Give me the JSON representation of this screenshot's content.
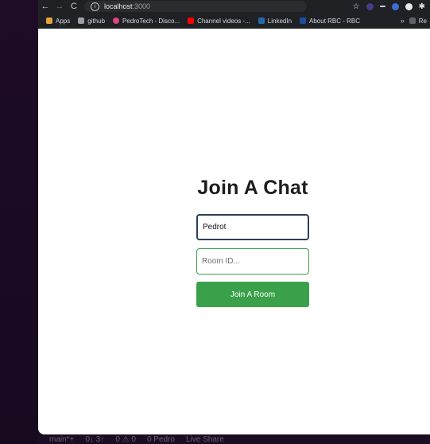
{
  "browser": {
    "url_host": "localhost",
    "url_port": ":3000",
    "bookmarks": [
      {
        "label": "Apps",
        "icon": "apps-grid-icon",
        "color": "#e8a13a"
      },
      {
        "label": "github",
        "icon": "folder-icon",
        "color": "#9aa0a6"
      },
      {
        "label": "PedroTech - Disco...",
        "icon": "discord-icon",
        "color": "#e0457b"
      },
      {
        "label": "Channel videos -...",
        "icon": "youtube-icon",
        "color": "#ff0000"
      },
      {
        "label": "LinkedIn",
        "icon": "linkedin-icon",
        "color": "#2867b2"
      },
      {
        "label": "About RBC - RBC",
        "icon": "rbc-icon",
        "color": "#1a4fa0"
      }
    ],
    "more_label": "»",
    "reading_list_label": "Re"
  },
  "page": {
    "title": "Join A Chat",
    "username_value": "Pedrot",
    "room_placeholder": "Room ID...",
    "join_button": "Join A Room"
  },
  "statusbar": {
    "branch": "main*+",
    "sync": "0↓ 3↑",
    "problems": "0 ⚠ 0",
    "user": "0  Pedro",
    "live_share": "Live Share"
  },
  "colors": {
    "accent": "#3aa14a",
    "focus_border": "#2d3f57",
    "chrome_bg": "#202124"
  }
}
